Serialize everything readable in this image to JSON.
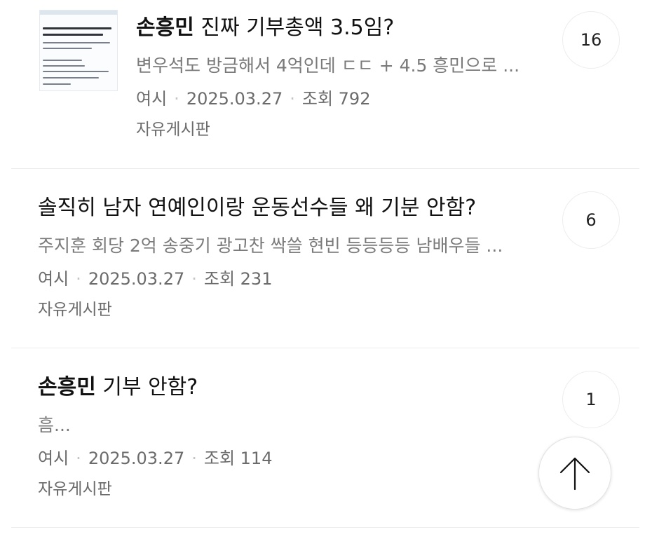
{
  "posts": [
    {
      "title_highlight": "손흥민",
      "title_rest": " 진짜 기부총액 3.5임?",
      "excerpt": "변우석도 방금해서 4억인데 ㄷㄷ + 4.5 흥민으로 ...",
      "author": "여시",
      "date": "2025.03.27",
      "views": "조회 792",
      "board": "자유게시판",
      "comment_count": "16",
      "has_thumbnail": true
    },
    {
      "title_highlight": "",
      "title_rest": "솔직히 남자 연예인이랑 운동선수들 왜 기분 안함?",
      "excerpt": "주지훈 회당 2억 송중기 광고찬 싹쓸 현빈 등등등등 남배우들 ...",
      "author": "여시",
      "date": "2025.03.27",
      "views": "조회 231",
      "board": "자유게시판",
      "comment_count": "6",
      "has_thumbnail": false
    },
    {
      "title_highlight": "손흥민",
      "title_rest": " 기부 안함?",
      "excerpt": "흠...",
      "author": "여시",
      "date": "2025.03.27",
      "views": "조회 114",
      "board": "자유게시판",
      "comment_count": "1",
      "has_thumbnail": false
    }
  ],
  "scroll_top_button": {
    "icon": "arrow-up-icon"
  },
  "colors": {
    "title": "#111111",
    "excerpt": "#7a7a7a",
    "meta": "#6b6b6b",
    "divider": "#ececec"
  }
}
